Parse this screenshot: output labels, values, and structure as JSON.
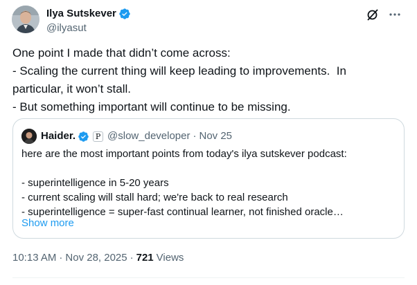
{
  "author": {
    "name": "Ilya Sutskever",
    "handle": "@ilyasut",
    "verified": true
  },
  "actions": {
    "grok_icon": "grok-icon",
    "more_icon": "more-icon"
  },
  "post": {
    "lines": [
      "One point I made that didn’t come across:",
      "- Scaling the current thing will keep leading to improvements.  In",
      "particular, it won’t stall.",
      "- But something important will continue to be missing."
    ]
  },
  "quote": {
    "name": "Haider.",
    "verified": true,
    "affiliate_badge": "P",
    "handle": "@slow_developer",
    "dot": "·",
    "date": "Nov 25",
    "lines": [
      "here are the most important points from today's ilya sutskever podcast:",
      "",
      "- superintelligence in 5-20 years",
      "- current scaling will stall hard; we're back to real research",
      "- superintelligence = super-fast continual learner, not finished oracle…"
    ],
    "show_more": "Show more"
  },
  "meta": {
    "time": "10:13 AM",
    "sep": "·",
    "date": "Nov 28, 2025",
    "views_count": "721",
    "views_label": "Views"
  },
  "colors": {
    "text": "#0f1419",
    "secondary": "#536471",
    "link": "#1d9bf0",
    "border": "#cfd9de"
  }
}
